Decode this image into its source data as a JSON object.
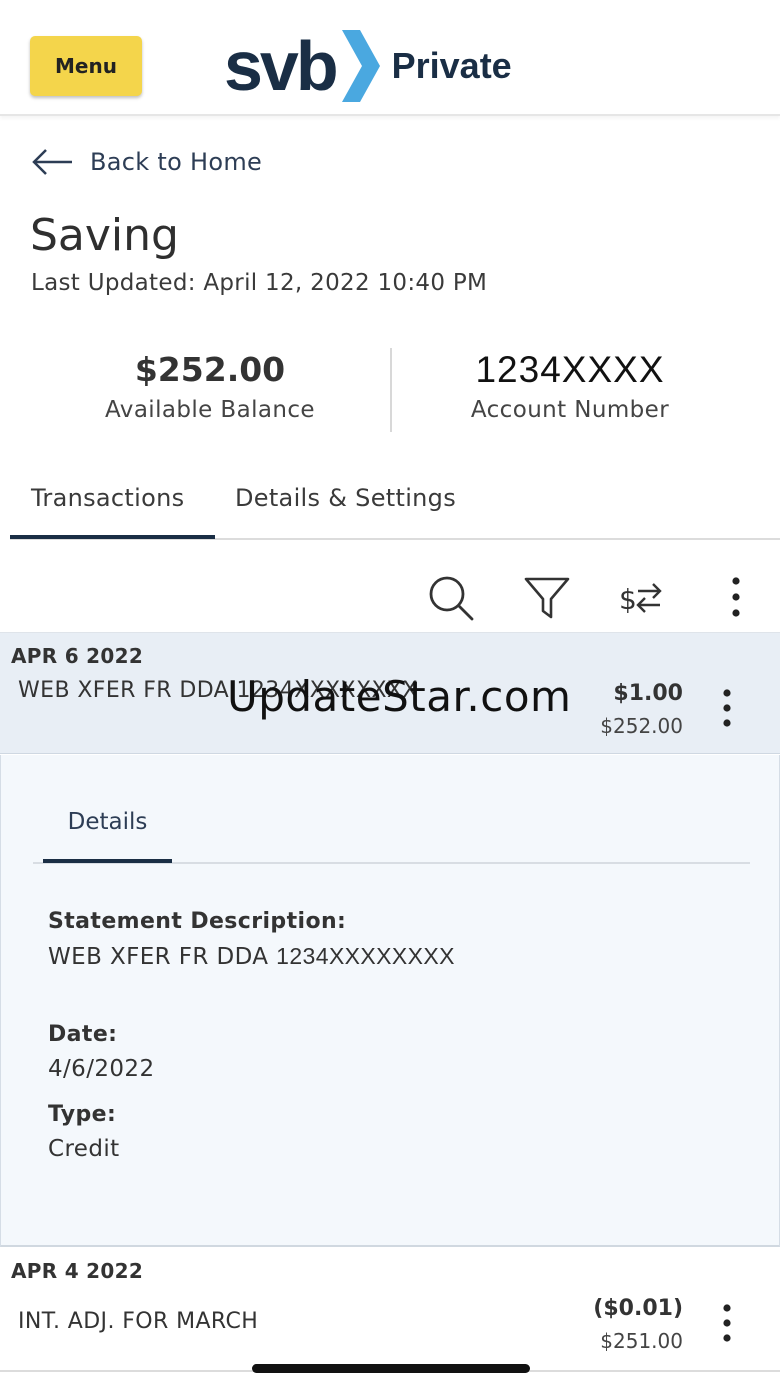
{
  "header": {
    "menu_label": "Menu",
    "logo_brand": "svb",
    "logo_sub": "Private",
    "brand_color": "#1a2e45",
    "accent_color": "#4aa8e0",
    "menu_color": "#f4d54b"
  },
  "nav": {
    "back_label": "Back to Home"
  },
  "account": {
    "title": "Saving",
    "last_updated": "Last Updated: April 12, 2022 10:40 PM",
    "balance_value": "$252.00",
    "balance_label": "Available Balance",
    "number_value": "1234XXXX",
    "number_label": "Account Number"
  },
  "tabs": [
    {
      "label": "Transactions",
      "active": true
    },
    {
      "label": "Details & Settings",
      "active": false
    }
  ],
  "toolbar": {
    "icons": [
      "search-icon",
      "filter-icon",
      "transfer-icon",
      "more-vertical-icon"
    ]
  },
  "transactions": [
    {
      "date": "APR 6 2022",
      "description": "WEB XFER FR DDA 1234XXXXXXXX",
      "amount": "$1.00",
      "balance": "$252.00",
      "expanded": true,
      "details": {
        "tab_label": "Details",
        "statement_label": "Statement Description:",
        "statement_prefix": "WEB XFER FR DDA ",
        "statement_masked": "1234XXXXXXXX",
        "date_label": "Date:",
        "date_value": "4/6/2022",
        "type_label": "Type:",
        "type_value": "Credit"
      }
    },
    {
      "date": "APR 4 2022",
      "description": "INT. ADJ. FOR MARCH",
      "amount": "($0.01)",
      "balance": "$251.00",
      "expanded": false
    }
  ],
  "watermark": "UpdateStar.com"
}
